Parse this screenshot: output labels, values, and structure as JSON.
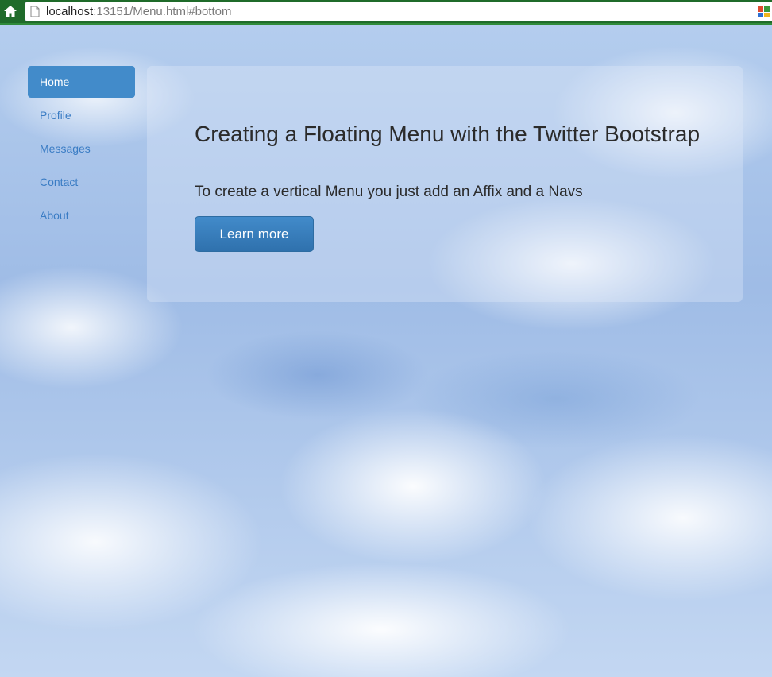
{
  "browser": {
    "url_host": "localhost",
    "url_rest": ":13151/Menu.html#bottom",
    "home_icon": "home-icon",
    "page_icon": "page-icon",
    "extension_icon": "extension-icon",
    "chrome_color": "#1f6b2a"
  },
  "nav": {
    "items": [
      {
        "label": "Home",
        "active": true
      },
      {
        "label": "Profile",
        "active": false
      },
      {
        "label": "Messages",
        "active": false
      },
      {
        "label": "Contact",
        "active": false
      },
      {
        "label": "About",
        "active": false
      }
    ],
    "active_color": "#428bca",
    "link_color": "#3a7cc4"
  },
  "jumbotron": {
    "title": "Creating a Floating Menu with the Twitter Bootstrap",
    "lead": "To create a vertical Menu you just add an Affix and a Navs",
    "button_label": "Learn more",
    "button_color": "#428bca"
  }
}
